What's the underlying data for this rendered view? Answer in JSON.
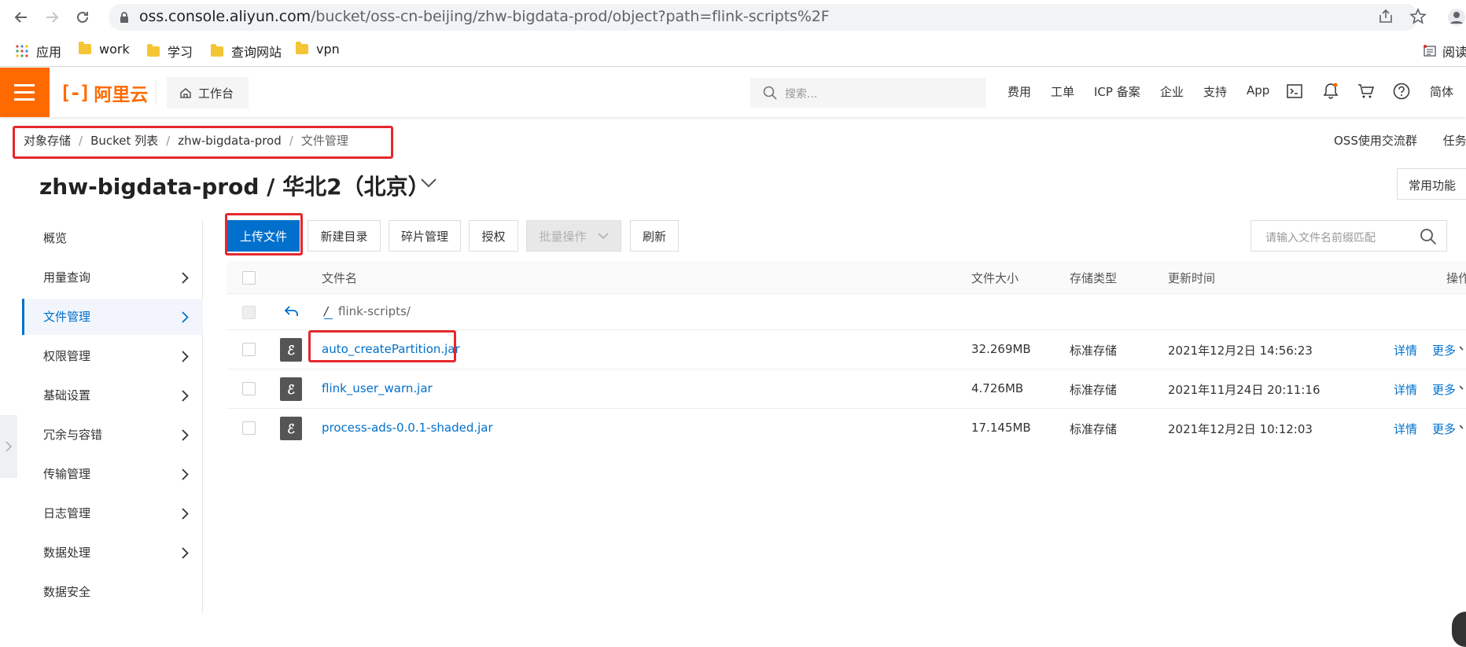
{
  "browser": {
    "url_host": "oss.console.aliyun.com",
    "url_path": "/bucket/oss-cn-beijing/zhw-bigdata-prod/object?path=flink-scripts%2F",
    "bookmarks": [
      {
        "label": "应用"
      },
      {
        "label": "work"
      },
      {
        "label": "学习"
      },
      {
        "label": "查询网站"
      },
      {
        "label": "vpn"
      }
    ],
    "reading_list_label": "阅读"
  },
  "header": {
    "logo_text": "阿里云",
    "workbench_label": "工作台",
    "search_placeholder": "搜索...",
    "nav": [
      "费用",
      "工单",
      "ICP 备案",
      "企业",
      "支持",
      "App"
    ],
    "lang_label": "简体"
  },
  "breadcrumb": [
    "对象存储",
    "Bucket 列表",
    "zhw-bigdata-prod",
    "文件管理"
  ],
  "top_links": [
    "OSS使用交流群",
    "任务列"
  ],
  "page": {
    "title": "zhw-bigdata-prod / 华北2（北京）",
    "common_functions_label": "常用功能"
  },
  "sidebar": {
    "items": [
      {
        "label": "概览",
        "has_chevron": false
      },
      {
        "label": "用量查询",
        "has_chevron": true
      },
      {
        "label": "文件管理",
        "has_chevron": true,
        "active": true
      },
      {
        "label": "权限管理",
        "has_chevron": true
      },
      {
        "label": "基础设置",
        "has_chevron": true
      },
      {
        "label": "冗余与容错",
        "has_chevron": true
      },
      {
        "label": "传输管理",
        "has_chevron": true
      },
      {
        "label": "日志管理",
        "has_chevron": true
      },
      {
        "label": "数据处理",
        "has_chevron": true
      },
      {
        "label": "数据安全",
        "has_chevron": false
      }
    ]
  },
  "toolbar": {
    "upload_label": "上传文件",
    "new_dir_label": "新建目录",
    "fragment_label": "碎片管理",
    "authorize_label": "授权",
    "batch_label": "批量操作",
    "refresh_label": "刷新",
    "search_placeholder": "请输入文件名前缀匹配"
  },
  "table": {
    "columns": {
      "name": "文件名",
      "size": "文件大小",
      "storage": "存储类型",
      "updated": "更新时间",
      "actions": "操作"
    },
    "path_row": {
      "root": "/",
      "path": "flink-scripts/"
    },
    "rows": [
      {
        "name": "auto_createPartition.jar",
        "size": "32.269MB",
        "storage": "标准存储",
        "updated": "2021年12月2日 14:56:23",
        "detail": "详情",
        "more": "更多"
      },
      {
        "name": "flink_user_warn.jar",
        "size": "4.726MB",
        "storage": "标准存储",
        "updated": "2021年11月24日 20:11:16",
        "detail": "详情",
        "more": "更多"
      },
      {
        "name": "process-ads-0.0.1-shaded.jar",
        "size": "17.145MB",
        "storage": "标准存储",
        "updated": "2021年12月2日 10:12:03",
        "detail": "详情",
        "more": "更多"
      }
    ]
  },
  "colors": {
    "brand_orange": "#ff6a00",
    "primary_blue": "#0070cc",
    "highlight_red": "#e5282c"
  }
}
